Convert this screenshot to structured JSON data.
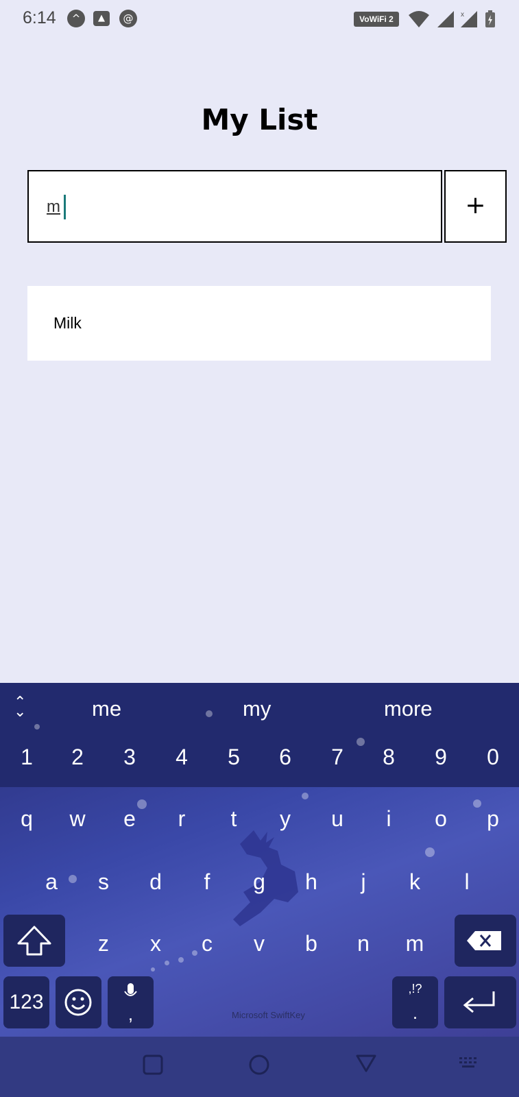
{
  "status_bar": {
    "time": "6:14",
    "wifi_badge": "VoWiFi 2"
  },
  "app": {
    "title": "My List"
  },
  "input": {
    "value": "m",
    "add_label": "+"
  },
  "list": {
    "items": [
      "Milk"
    ]
  },
  "keyboard": {
    "suggestions": [
      "me",
      "my",
      "more"
    ],
    "number_row": [
      "1",
      "2",
      "3",
      "4",
      "5",
      "6",
      "7",
      "8",
      "9",
      "0"
    ],
    "row1": [
      "q",
      "w",
      "e",
      "r",
      "t",
      "y",
      "u",
      "i",
      "o",
      "p"
    ],
    "row2": [
      "a",
      "s",
      "d",
      "f",
      "g",
      "h",
      "j",
      "k",
      "l"
    ],
    "row3": [
      "z",
      "x",
      "c",
      "v",
      "b",
      "n",
      "m"
    ],
    "numbers_key": "123",
    "comma_key": ",",
    "punct_key_top": ",!?",
    "punct_key_bottom": ".",
    "brand": "Microsoft SwiftKey"
  }
}
